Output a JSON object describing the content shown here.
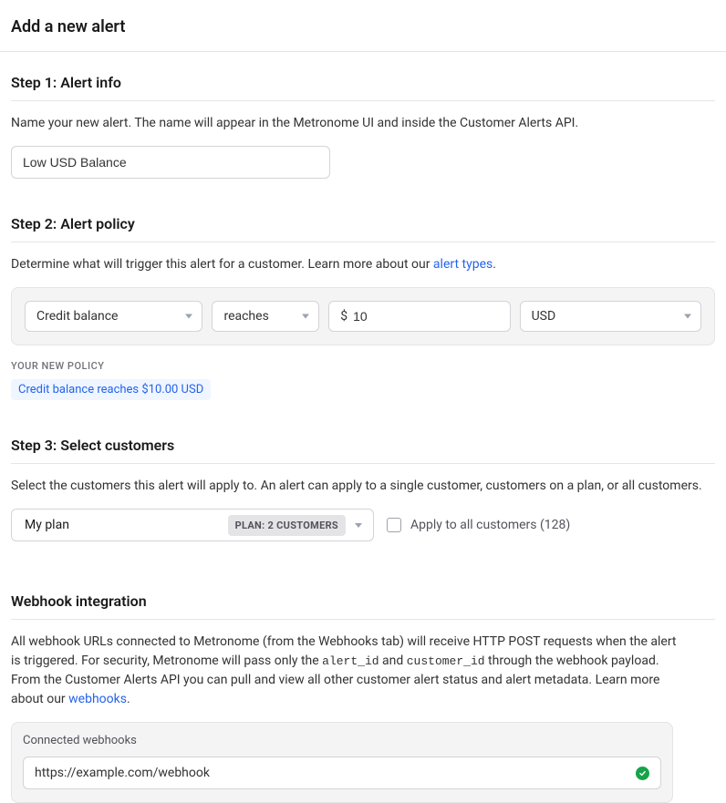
{
  "header": {
    "title": "Add a new alert"
  },
  "step1": {
    "title": "Step 1: Alert info",
    "desc": "Name your new alert. The name will appear in the Metronome UI and inside the Customer Alerts API.",
    "nameValue": "Low USD Balance"
  },
  "step2": {
    "title": "Step 2: Alert policy",
    "descPrefix": "Determine what will trigger this alert for a customer. Learn more about our ",
    "linkText": "alert types",
    "descSuffix": ".",
    "metric": "Credit balance",
    "condition": "reaches",
    "thresholdPrefix": "$",
    "thresholdValue": "10",
    "currency": "USD",
    "policyLabel": "YOUR NEW POLICY",
    "policySummary": "Credit balance reaches $10.00 USD"
  },
  "step3": {
    "title": "Step 3: Select customers",
    "desc": "Select the customers this alert will apply to. An alert can apply to a single customer, customers on a plan, or all customers.",
    "planName": "My plan",
    "planBadge": "PLAN: 2 CUSTOMERS",
    "applyAllLabel": "Apply to all customers (128)"
  },
  "webhooks": {
    "title": "Webhook integration",
    "descPart1": "All webhook URLs connected to Metronome (from the Webhooks tab) will receive HTTP POST requests when the alert is triggered. For security, Metronome will pass only the ",
    "code1": "alert_id",
    "descPart2": " and ",
    "code2": "customer_id",
    "descPart3": " through the webhook payload. From the Customer Alerts API you can pull and view all other customer alert status and alert metadata. Learn more about our ",
    "linkText": "webhooks",
    "descSuffix": ".",
    "boxLabel": "Connected webhooks",
    "url": "https://example.com/webhook"
  }
}
